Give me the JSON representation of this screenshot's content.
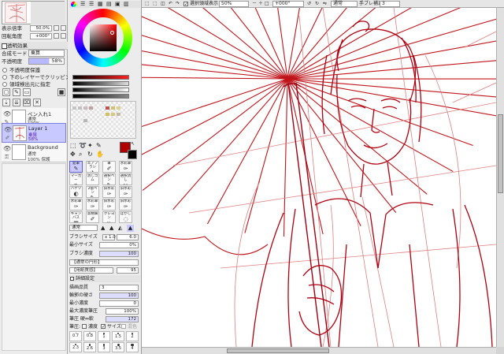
{
  "navigator": {
    "zoom_label": "表示倍率",
    "zoom_value": "50.0%",
    "rotate_label": "回転角度",
    "rotate_value": "+000°"
  },
  "layer_effects": {
    "header": "透明効果",
    "blend_label": "合成モード",
    "blend_value": "乗算",
    "opacity_label": "不透明度",
    "opacity_value": "58%",
    "options": [
      "不透明度保護",
      "下のレイヤーでクリッピング",
      "領域検出元に指定"
    ]
  },
  "layers": [
    {
      "name": "ペン入れ1",
      "mode": "通常",
      "opacity": "100%",
      "selected": false
    },
    {
      "name": "Layer 1",
      "mode": "乗算",
      "opacity": "58%",
      "selected": true
    },
    {
      "name": "Background",
      "mode": "通常",
      "opacity": "100% 保護",
      "selected": false
    }
  ],
  "tools": {
    "row1": [
      {
        "label": "鉛筆",
        "icon": "pencil-icon"
      },
      {
        "label": "エアブラシ",
        "icon": "airbrush-icon"
      },
      {
        "label": "筆",
        "icon": "brush-icon"
      },
      {
        "label": "水彩筆",
        "icon": "watercolor-icon"
      }
    ],
    "row2": [
      {
        "label": "マーカー",
        "icon": "marker-icon"
      },
      {
        "label": "消しゴム",
        "icon": "eraser-icon"
      },
      {
        "label": "選択ペン",
        "icon": "select-pen-icon"
      },
      {
        "label": "選択消し",
        "icon": "select-erase-icon"
      }
    ],
    "row3": [
      {
        "label": "バケツ",
        "icon": "bucket-icon"
      },
      {
        "label": "2値ペン",
        "icon": "binary-pen-icon"
      },
      {
        "label": "旧水彩",
        "icon": "old-watercolor-icon"
      },
      {
        "label": "旧水彩",
        "icon": "old-watercolor-2-icon"
      }
    ],
    "row4": [
      {
        "label": "水彩筆",
        "icon": "watercolor-2-icon"
      },
      {
        "label": "水彩筆",
        "icon": "watercolor-3-icon"
      },
      {
        "label": "旧水彩",
        "icon": "old-watercolor-3-icon"
      },
      {
        "label": "旧水彩",
        "icon": "old-watercolor-4-icon"
      }
    ],
    "row5": [
      {
        "label": "キャンバス",
        "icon": "canvas-icon"
      },
      {
        "label": "高精細",
        "icon": "hires-icon"
      },
      {
        "label": "クレヨン",
        "icon": "crayon-icon"
      },
      {
        "label": "ぼかし",
        "icon": "blur-icon"
      }
    ]
  },
  "brush": {
    "mode": "通常",
    "size_label": "ブラシサイズ",
    "size_mult": "x 1.0",
    "size_value": "6.0",
    "min_size_label": "最小サイズ",
    "min_size_value": "0%",
    "density_label": "ブラシ濃度",
    "density_value": "100",
    "shape": "【通常の円形】",
    "texture": "【用紙質感】",
    "texture_value": "95",
    "detail_header": "詳細設定",
    "quality_label": "描画品質",
    "quality_value": "3",
    "edge_label": "輪郭の硬さ",
    "edge_value": "100",
    "min_density_label": "最小濃度",
    "min_density_value": "0",
    "max_pressure_label": "最大濃度筆圧",
    "max_pressure_value": "100%",
    "pressure_label": "筆圧 硬⇔軟",
    "pressure_value": "172",
    "pressure_chk_label": "筆圧:",
    "density_chk": "濃度",
    "size_chk": "サイズ",
    "blend_chk": "混色",
    "sizes": [
      "0.7",
      "0.8",
      "1",
      "1.5",
      "2",
      "2.3",
      "2.6",
      "3",
      "3.5",
      "4"
    ]
  },
  "toolbar": {
    "selection_label": "選択領域表示",
    "zoom": "50%",
    "angle": "+000°",
    "mode": "通常",
    "stabilizer_label": "手ブレ補正",
    "stabilizer_value": "3"
  },
  "colors": {
    "primary": "#b00000",
    "secondary": "#000000",
    "sketch": "#c0141a",
    "sketch_light": "#e08080",
    "selected_layer": "#c7c9ff"
  }
}
